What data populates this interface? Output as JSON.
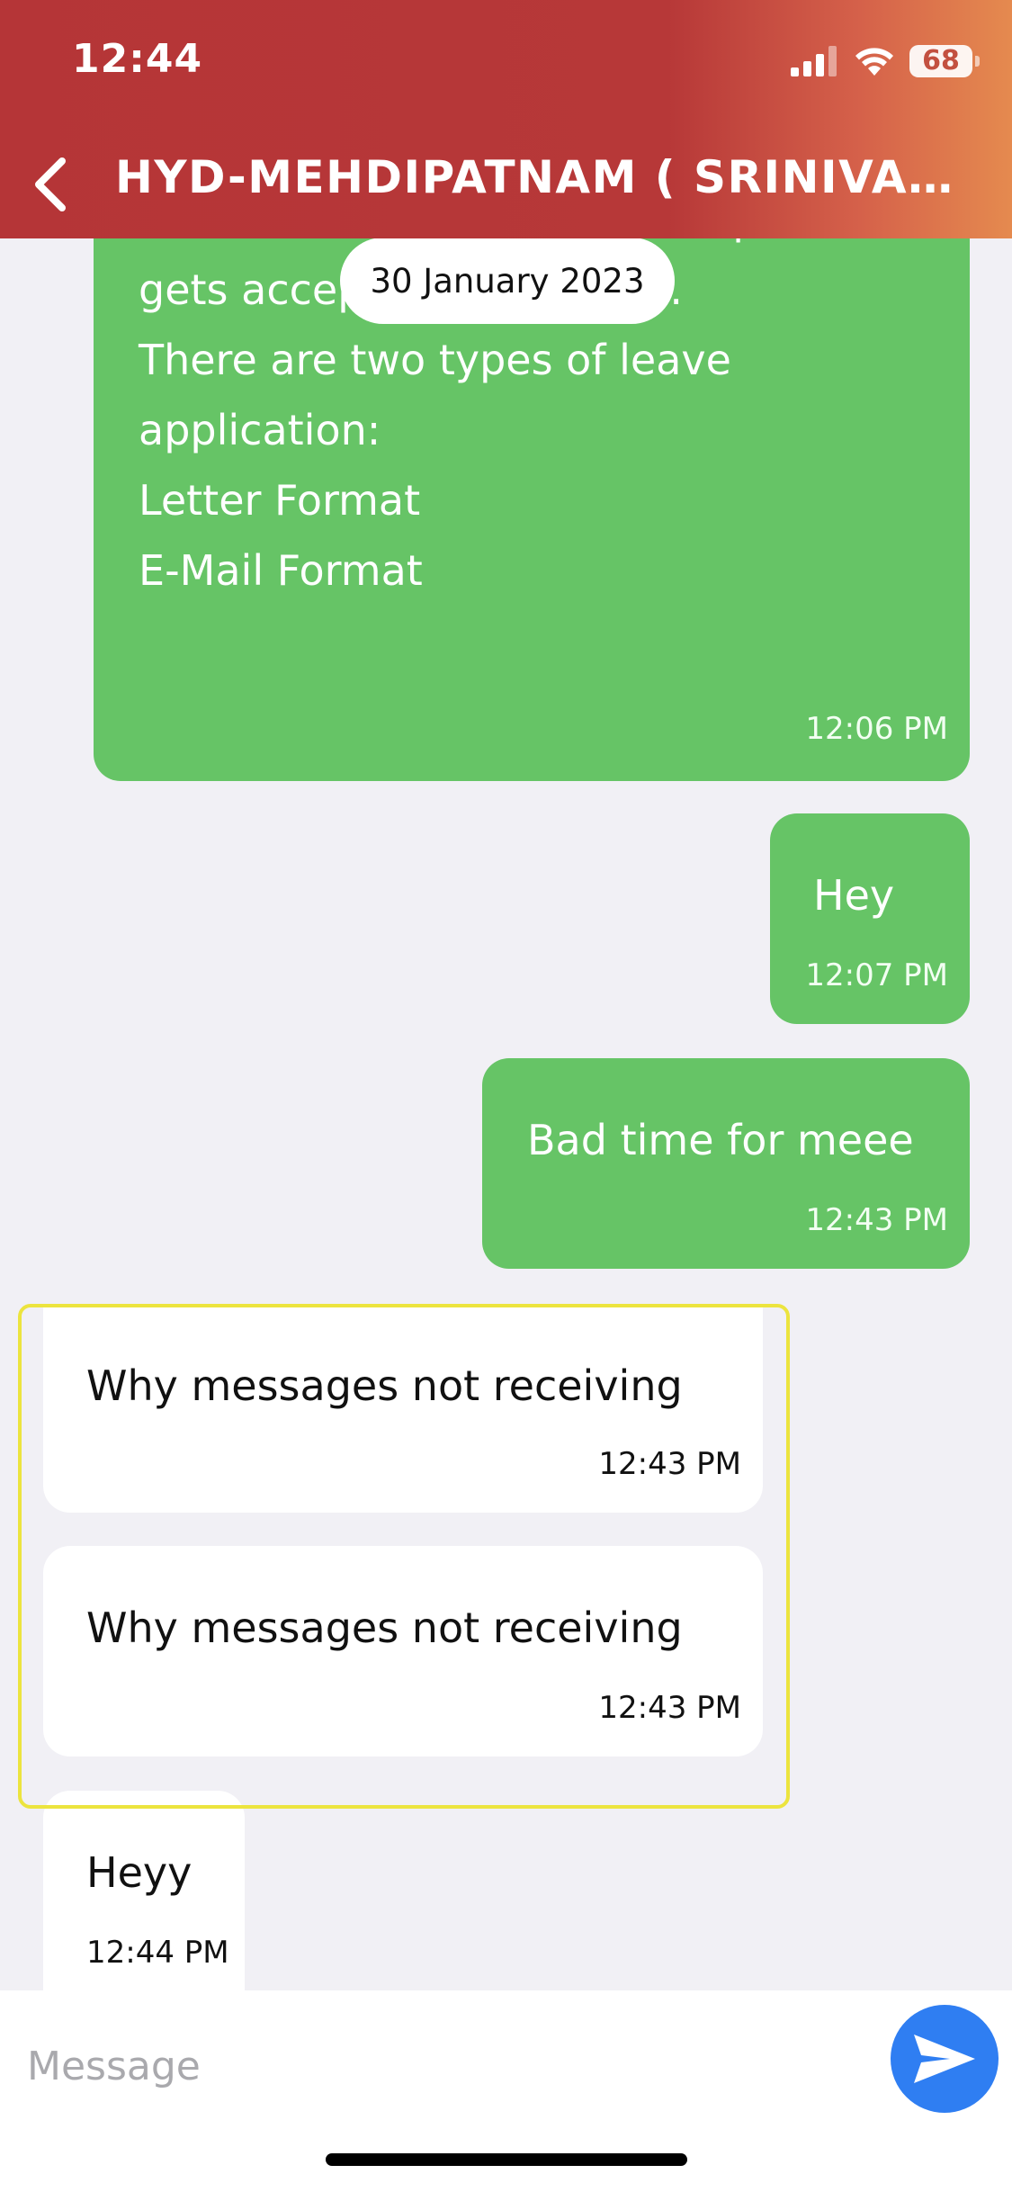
{
  "status_bar": {
    "time": "12:44",
    "battery": "68"
  },
  "header": {
    "title": "HYD-MEHDIPATNAM ( SRINIVAS M..."
  },
  "date_separator": "30 January 2023",
  "messages": [
    {
      "direction": "outgoing",
      "text": "decide w              ve request\ngets accepted or rejected.\nThere are two types of leave\napplication:\nLetter Format\nE-Mail Format",
      "time": "12:06 PM"
    },
    {
      "direction": "outgoing",
      "text": "Hey",
      "time": "12:07 PM"
    },
    {
      "direction": "outgoing",
      "text": "Bad time for meee",
      "time": "12:43 PM"
    },
    {
      "direction": "incoming",
      "text": "Why messages not receiving",
      "time": "12:43 PM"
    },
    {
      "direction": "incoming",
      "text": "Why messages not receiving",
      "time": "12:43 PM"
    },
    {
      "direction": "incoming",
      "text": "Heyy",
      "time": "12:44 PM"
    }
  ],
  "composer": {
    "placeholder": "Message"
  },
  "colors": {
    "header_red": "#b53537",
    "header_orange": "#e58a4f",
    "outgoing_bubble": "#66c466",
    "incoming_bubble": "#ffffff",
    "background": "#f1f0f5",
    "send_button": "#2f7ef2",
    "highlight": "#ece43e"
  }
}
